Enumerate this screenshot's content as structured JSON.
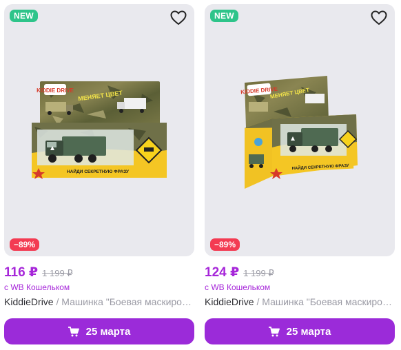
{
  "products": [
    {
      "badge_new": "NEW",
      "discount": "−89%",
      "price": "116 ₽",
      "old_price": "1 199 ₽",
      "wallet_note": "с WB Кошельком",
      "brand": "KiddieDrive",
      "separator": " / ",
      "name": "Машинка \"Боевая маскировка\"",
      "cart_label": "25 марта",
      "box_logo": "KIDDIE DRIVE",
      "box_caption": "МЕНЯЕТ ЦВЕТ",
      "box_bottom": "НАЙДИ СЕКРЕТНУЮ ФРАЗУ"
    },
    {
      "badge_new": "NEW",
      "discount": "−89%",
      "price": "124 ₽",
      "old_price": "1 199 ₽",
      "wallet_note": "с WB Кошельком",
      "brand": "KiddieDrive",
      "separator": " / ",
      "name": "Машинка \"Боевая маскировка\"",
      "cart_label": "25 марта",
      "box_logo": "KIDDIE DRIVE",
      "box_caption": "МЕНЯЕТ ЦВЕТ",
      "box_bottom": "НАЙДИ СЕКРЕТНУЮ ФРАЗУ"
    }
  ],
  "colors": {
    "accent": "#a626d9",
    "button": "#9b2bd9",
    "badge_new": "#2ec48a",
    "badge_discount": "#f33b52",
    "image_bg": "#e9e9ee"
  },
  "icons": {
    "favorite": "heart-outline-icon",
    "cart": "cart-icon"
  }
}
